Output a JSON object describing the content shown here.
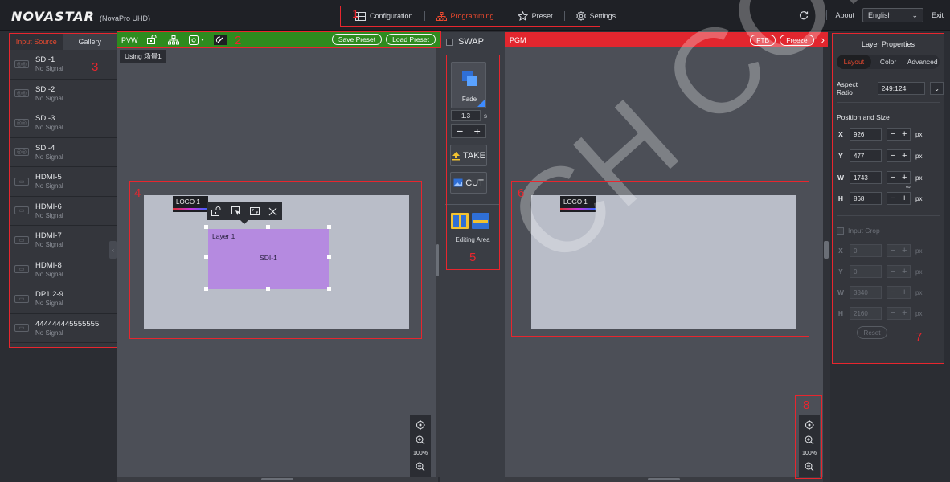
{
  "header": {
    "brand": "NOVASTAR",
    "product": "(NovaPro UHD)",
    "nav": [
      {
        "label": "Configuration",
        "icon": "grid-icon",
        "active": false
      },
      {
        "label": "Programming",
        "icon": "hierarchy-icon",
        "active": true
      },
      {
        "label": "Preset",
        "icon": "star-icon",
        "active": false
      },
      {
        "label": "Settings",
        "icon": "gear-icon",
        "active": false
      }
    ],
    "about": "About",
    "language": "English",
    "exit": "Exit"
  },
  "sources": {
    "tabs": [
      {
        "label": "Input Source",
        "active": true
      },
      {
        "label": "Gallery",
        "active": false
      }
    ],
    "items": [
      {
        "name": "SDI-1",
        "status": "No Signal"
      },
      {
        "name": "SDI-2",
        "status": "No Signal"
      },
      {
        "name": "SDI-3",
        "status": "No Signal"
      },
      {
        "name": "SDI-4",
        "status": "No Signal"
      },
      {
        "name": "HDMI-5",
        "status": "No Signal"
      },
      {
        "name": "HDMI-6",
        "status": "No Signal"
      },
      {
        "name": "HDMI-7",
        "status": "No Signal"
      },
      {
        "name": "HDMI-8",
        "status": "No Signal"
      },
      {
        "name": "DP1.2-9",
        "status": "No Signal"
      },
      {
        "name": "444444445555555",
        "status": "No Signal"
      }
    ]
  },
  "preview": {
    "label": "PVW",
    "save_preset": "Save Preset",
    "load_preset": "Load Preset",
    "using": "Using 场景1",
    "logo_label": "LOGO 1",
    "layer_label": "Layer 1",
    "layer_source": "SDI-1",
    "zoom": "100%"
  },
  "control": {
    "swap": "SWAP",
    "effect": "Fade",
    "duration": "1.3",
    "duration_unit": "s",
    "take": "TAKE",
    "cut": "CUT",
    "editing_area": "Editing Area"
  },
  "program": {
    "label": "PGM",
    "ftb": "FTB",
    "freeze": "Freeze",
    "logo_label": "LOGO 1",
    "zoom": "100%"
  },
  "properties": {
    "title": "Layer Properties",
    "tabs": [
      {
        "label": "Layout",
        "active": true
      },
      {
        "label": "Color",
        "active": false
      },
      {
        "label": "Advanced",
        "active": false
      }
    ],
    "aspect_label": "Aspect Ratio",
    "aspect_value": "249:124",
    "section": "Position and Size",
    "fields": [
      {
        "key": "X",
        "value": "926",
        "unit": "px"
      },
      {
        "key": "Y",
        "value": "477",
        "unit": "px"
      },
      {
        "key": "W",
        "value": "1743",
        "unit": "px"
      },
      {
        "key": "H",
        "value": "868",
        "unit": "px"
      }
    ],
    "input_crop": "Input Crop",
    "crop_fields": [
      {
        "key": "X",
        "value": "0",
        "unit": "px"
      },
      {
        "key": "Y",
        "value": "0",
        "unit": "px"
      },
      {
        "key": "W",
        "value": "3840",
        "unit": "px"
      },
      {
        "key": "H",
        "value": "2160",
        "unit": "px"
      }
    ],
    "reset": "Reset"
  },
  "annotations": [
    "1",
    "2",
    "3",
    "4",
    "5",
    "6",
    "7",
    "8"
  ],
  "watermark": "CH CO., LTD."
}
